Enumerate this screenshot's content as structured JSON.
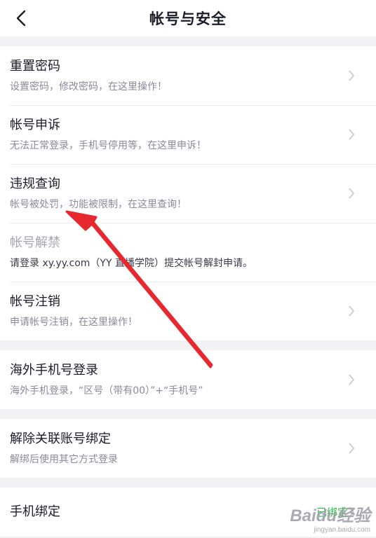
{
  "header": {
    "title": "帐号与安全",
    "back_icon": "chevron-left-icon"
  },
  "groups": [
    {
      "items": [
        {
          "title": "重置密码",
          "subtitle": "设置密码，修改密码，在这里操作！"
        },
        {
          "title": "帐号申诉",
          "subtitle": "无法正常登录，手机号停用等，在这里申诉！"
        },
        {
          "title": "违规查询",
          "subtitle": "帐号被处罚，功能被限制，在这里查询！"
        },
        {
          "title": "帐号解禁",
          "subtitle": "请登录 xy.yy.com（YY 直播学院）提交帐号解封申请。"
        },
        {
          "title": "帐号注销",
          "subtitle": "申请帐号注销，在这里操作！"
        }
      ]
    },
    {
      "items": [
        {
          "title": "海外手机号登录",
          "subtitle": "海外手机登录，“区号（带有00）”+“手机号”"
        }
      ]
    },
    {
      "items": [
        {
          "title": "解除关联账号绑定",
          "subtitle": "解绑后使用其它方式登录"
        }
      ]
    },
    {
      "items": [
        {
          "title": "手机绑定",
          "status": "已绑定"
        }
      ]
    }
  ],
  "watermark": {
    "logo": "Baidu经验",
    "url": "jingyan.baidu.com"
  },
  "colors": {
    "background": "#f2f2f4",
    "card": "#ffffff",
    "title_text": "#1c1c2a",
    "subtitle_text": "#8a8a98",
    "status_green": "#2fb84e",
    "annotation_arrow": "#e8282f"
  },
  "annotation": "red-arrow-pointing-to-violation-query"
}
